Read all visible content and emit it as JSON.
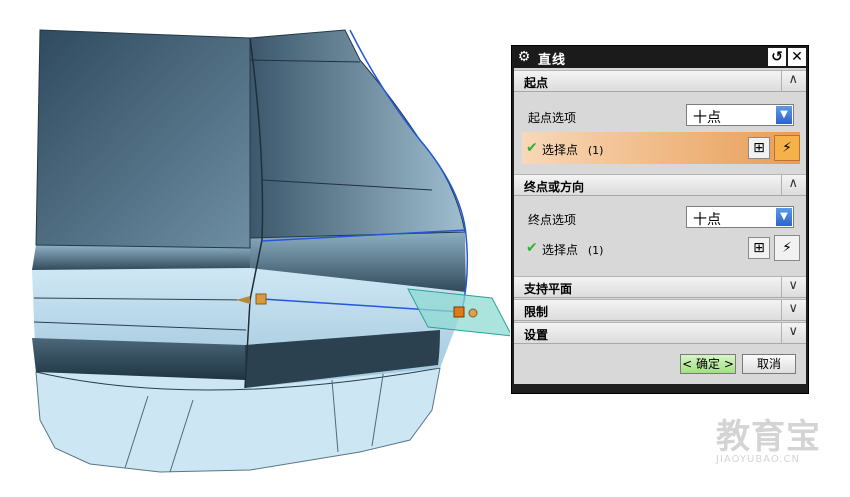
{
  "dialog": {
    "title": "直线",
    "icons": {
      "settings": "gear-icon",
      "reset": "reset-icon",
      "close": "close-icon"
    },
    "sections": {
      "start": {
        "header": "起点",
        "option_label": "起点选项",
        "option_value": "十点",
        "select_label": "选择点",
        "select_count": "(1)"
      },
      "end": {
        "header": "终点或方向",
        "option_label": "终点选项",
        "option_value": "十点",
        "select_label": "选择点",
        "select_count": "(1)"
      },
      "support": {
        "header": "支持平面"
      },
      "limit": {
        "header": "限制"
      },
      "settings": {
        "header": "设置"
      }
    },
    "buttons": {
      "ok": "确定",
      "cancel": "取消"
    }
  },
  "watermark": {
    "brand": "教育宝",
    "url": "JIAOYUBAO.CN"
  },
  "colors": {
    "accent_orange": "#e89d56",
    "model_blue": "#bfe0f0",
    "line_blue": "#2458d8"
  }
}
